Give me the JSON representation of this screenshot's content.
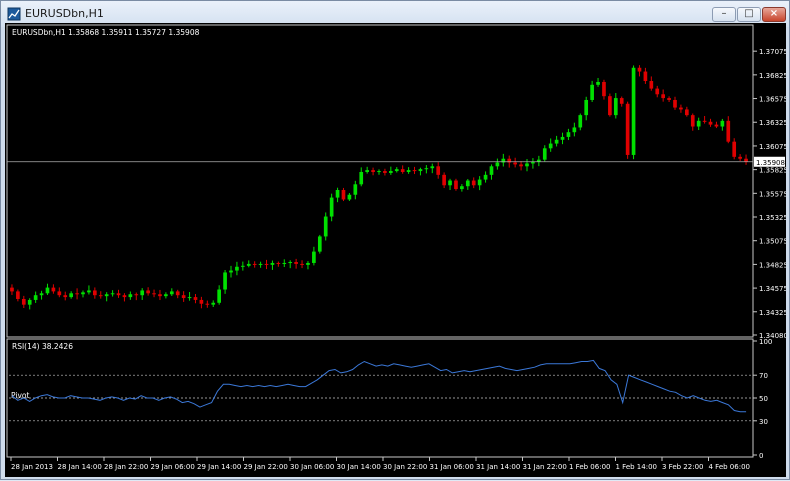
{
  "window": {
    "title": "EURUSDbn,H1",
    "minimize_label": "–",
    "maximize_label": "□",
    "close_label": "×"
  },
  "chart_data": {
    "type": "candlestick",
    "symbol_header": "EURUSDbn,H1  1.35868 1.35911 1.35727 1.35908",
    "current_price_label": "1.35908",
    "current_price": 1.35908,
    "y_ticks": [
      "1.37075",
      "1.36825",
      "1.36575",
      "1.36325",
      "1.36075",
      "1.35825",
      "1.35575",
      "1.35325",
      "1.35075",
      "1.34825",
      "1.34575",
      "1.34325",
      "1.34080"
    ],
    "ylim": [
      1.3408,
      1.3733
    ],
    "x_ticks": [
      "28 Jan 2013",
      "28 Jan 14:00",
      "28 Jan 22:00",
      "29 Jan 06:00",
      "29 Jan 14:00",
      "29 Jan 22:00",
      "30 Jan 06:00",
      "30 Jan 14:00",
      "30 Jan 22:00",
      "31 Jan 06:00",
      "31 Jan 14:00",
      "31 Jan 22:00",
      "1 Feb 06:00",
      "1 Feb 14:00",
      "3 Feb 22:00",
      "4 Feb 06:00"
    ],
    "candle_color_up": "#00e000",
    "candle_color_down": "#e00000",
    "candles_close": [
      1.3454,
      1.3446,
      1.344,
      1.3445,
      1.345,
      1.3452,
      1.3458,
      1.3454,
      1.345,
      1.3448,
      1.3452,
      1.3451,
      1.3453,
      1.3455,
      1.345,
      1.3449,
      1.3451,
      1.3452,
      1.345,
      1.3448,
      1.3451,
      1.345,
      1.3455,
      1.3452,
      1.3451,
      1.3449,
      1.3451,
      1.3454,
      1.345,
      1.3447,
      1.3448,
      1.3445,
      1.3441,
      1.344,
      1.3442,
      1.3456,
      1.3474,
      1.3476,
      1.348,
      1.3481,
      1.3483,
      1.3482,
      1.3483,
      1.3482,
      1.3484,
      1.3483,
      1.3484,
      1.3485,
      1.3483,
      1.3482,
      1.3484,
      1.3496,
      1.3512,
      1.3533,
      1.3553,
      1.3561,
      1.3551,
      1.3556,
      1.3567,
      1.358,
      1.3582,
      1.358,
      1.3581,
      1.3579,
      1.3581,
      1.3583,
      1.358,
      1.3582,
      1.3581,
      1.3583,
      1.3584,
      1.3586,
      1.3577,
      1.3566,
      1.3571,
      1.3562,
      1.3565,
      1.3571,
      1.3566,
      1.3572,
      1.3577,
      1.3586,
      1.359,
      1.3594,
      1.359,
      1.3588,
      1.3586,
      1.3589,
      1.3591,
      1.3593,
      1.3605,
      1.361,
      1.3614,
      1.3617,
      1.3622,
      1.3627,
      1.364,
      1.3656,
      1.3672,
      1.3675,
      1.366,
      1.364,
      1.3658,
      1.3652,
      1.3598,
      1.369,
      1.3686,
      1.3676,
      1.3668,
      1.3662,
      1.3658,
      1.3656,
      1.3648,
      1.3646,
      1.364,
      1.3628,
      1.3634,
      1.3633,
      1.363,
      1.3628,
      1.3634,
      1.3612,
      1.3596,
      1.3594,
      1.3591
    ],
    "rsi": {
      "label": "RSI(14) 38.2426",
      "y_ticks": [
        "100",
        "70",
        "50",
        "30",
        "0"
      ],
      "levels": [
        70,
        50,
        30
      ],
      "pivot_label": "Pivot",
      "line_color": "#3b78d8",
      "values": [
        52,
        48,
        50,
        47,
        50,
        52,
        53,
        51,
        50,
        50,
        52,
        51,
        50,
        50,
        49,
        48,
        50,
        51,
        50,
        48,
        50,
        49,
        52,
        50,
        50,
        48,
        50,
        51,
        49,
        46,
        47,
        45,
        42,
        44,
        46,
        56,
        62,
        62,
        61,
        60,
        61,
        60,
        61,
        60,
        61,
        60,
        61,
        62,
        61,
        60,
        60,
        63,
        66,
        70,
        74,
        75,
        72,
        73,
        75,
        79,
        82,
        80,
        78,
        79,
        78,
        80,
        79,
        78,
        77,
        78,
        79,
        80,
        77,
        74,
        75,
        72,
        73,
        74,
        73,
        74,
        75,
        76,
        77,
        78,
        76,
        75,
        74,
        75,
        76,
        77,
        79,
        80,
        80,
        80,
        80,
        80,
        81,
        82,
        82,
        83,
        76,
        74,
        66,
        62,
        46,
        70,
        68,
        66,
        64,
        62,
        60,
        58,
        56,
        55,
        52,
        50,
        52,
        50,
        48,
        47,
        48,
        46,
        44,
        39,
        38,
        38
      ]
    }
  }
}
